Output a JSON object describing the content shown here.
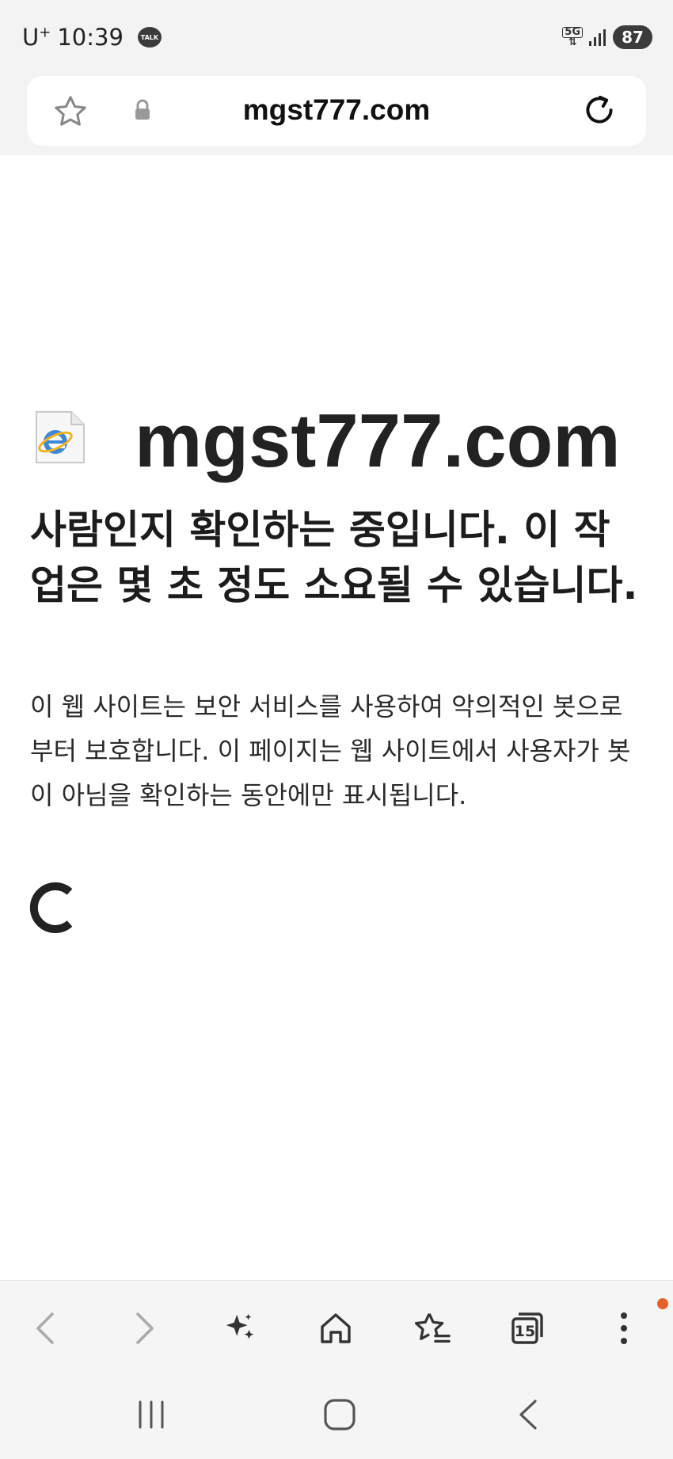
{
  "status_bar": {
    "carrier": "U",
    "carrier_sup": "+",
    "time": "10:39",
    "talk_badge": "TALK",
    "network": "5G",
    "battery": "87"
  },
  "url_bar": {
    "url": "mgst777.com",
    "star_icon": "star-outline-icon",
    "lock_icon": "lock-icon",
    "reload_icon": "reload-icon"
  },
  "page": {
    "site_name": "mgst777.com",
    "headline": "사람인지 확인하는 중입니다. 이 작업은 몇 초 정도 소요될 수 있습니다.",
    "description": "이 웹 사이트는 보안 서비스를 사용하여 악의적인 봇으로부터 보호합니다. 이 페이지는 웹 사이트에서 사용자가 봇이 아님을 확인하는 동안에만 표시됩니다."
  },
  "toolbar": {
    "tab_count": "15",
    "items": [
      "back-icon",
      "forward-icon",
      "ai-sparkle-icon",
      "home-icon",
      "bookmarks-icon",
      "tabs-icon",
      "more-icon"
    ],
    "notify_color": "#e5622a"
  },
  "navbar": {
    "items": [
      "recent-apps-icon",
      "home-nav-icon",
      "back-nav-icon"
    ]
  }
}
